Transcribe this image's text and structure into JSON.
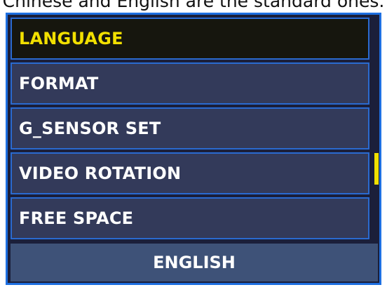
{
  "caption": "Chinese and English are the standard ones.",
  "menu": {
    "items": [
      {
        "label": "LANGUAGE"
      },
      {
        "label": "FORMAT"
      },
      {
        "label": "G_SENSOR SET"
      },
      {
        "label": "VIDEO ROTATION"
      },
      {
        "label": "FREE SPACE"
      }
    ],
    "selected_index": 0
  },
  "scroll": {
    "position_fraction": 0.7,
    "visible_fraction": 0.14
  },
  "value_bar": {
    "label": "ENGLISH"
  },
  "colors": {
    "border_blue": "#1e6fe0",
    "item_bg": "#333a5a",
    "selected_bg": "#16160e",
    "selected_text": "#f2e000",
    "value_bar_bg": "#3e5278"
  }
}
